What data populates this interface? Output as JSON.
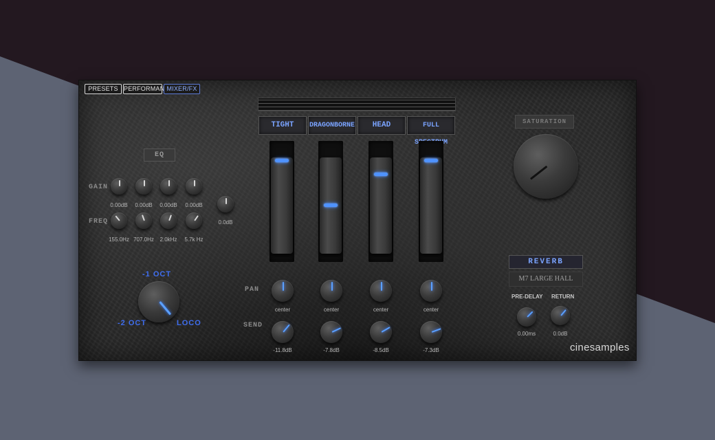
{
  "colors": {
    "background_top": "#231820",
    "background_slate": "#5d6373",
    "accent_blue": "#4f93ff",
    "panel": "#2b2b2b"
  },
  "nav": {
    "tabs": [
      {
        "label": "PRESETS",
        "active": false
      },
      {
        "label": "PERFORMANCE",
        "active": false
      },
      {
        "label": "MIXER/FX",
        "active": true
      }
    ]
  },
  "eq": {
    "button_label": "EQ",
    "gain_label": "GAIN",
    "freq_label": "FREQ",
    "gain_values": [
      "0.00dB",
      "0.00dB",
      "0.00dB",
      "0.00dB"
    ],
    "freq_values": [
      "155.0Hz",
      "707.0Hz",
      "2.0kHz",
      "5.7k Hz"
    ],
    "output_value": "0.0dB"
  },
  "octave": {
    "minus1_label": "-1 OCT",
    "minus2_label": "-2 OCT",
    "loco_label": "LOCO"
  },
  "mics": [
    {
      "name": "TIGHT",
      "fader_level": 0.95,
      "pan": "center",
      "send": "-11.8dB"
    },
    {
      "name": "DRAGONBORNE",
      "fader_level": 0.52,
      "pan": "center",
      "send": "-7.8dB"
    },
    {
      "name": "HEAD",
      "fader_level": 0.82,
      "pan": "center",
      "send": "-8.5dB"
    },
    {
      "name": "FULL SPECTRUM",
      "fader_level": 0.95,
      "pan": "center",
      "send": "-7.3dB"
    }
  ],
  "mixer": {
    "pan_label": "PAN",
    "send_label": "SEND"
  },
  "saturation": {
    "label": "SATURATION"
  },
  "reverb": {
    "title": "REVERB",
    "preset": "M7 LARGE HALL",
    "predelay_label": "PRE-DELAY",
    "return_label": "RETURN",
    "predelay_value": "0.00ms",
    "return_value": "0.0dB"
  },
  "brand": {
    "logo": "cinesamples"
  }
}
